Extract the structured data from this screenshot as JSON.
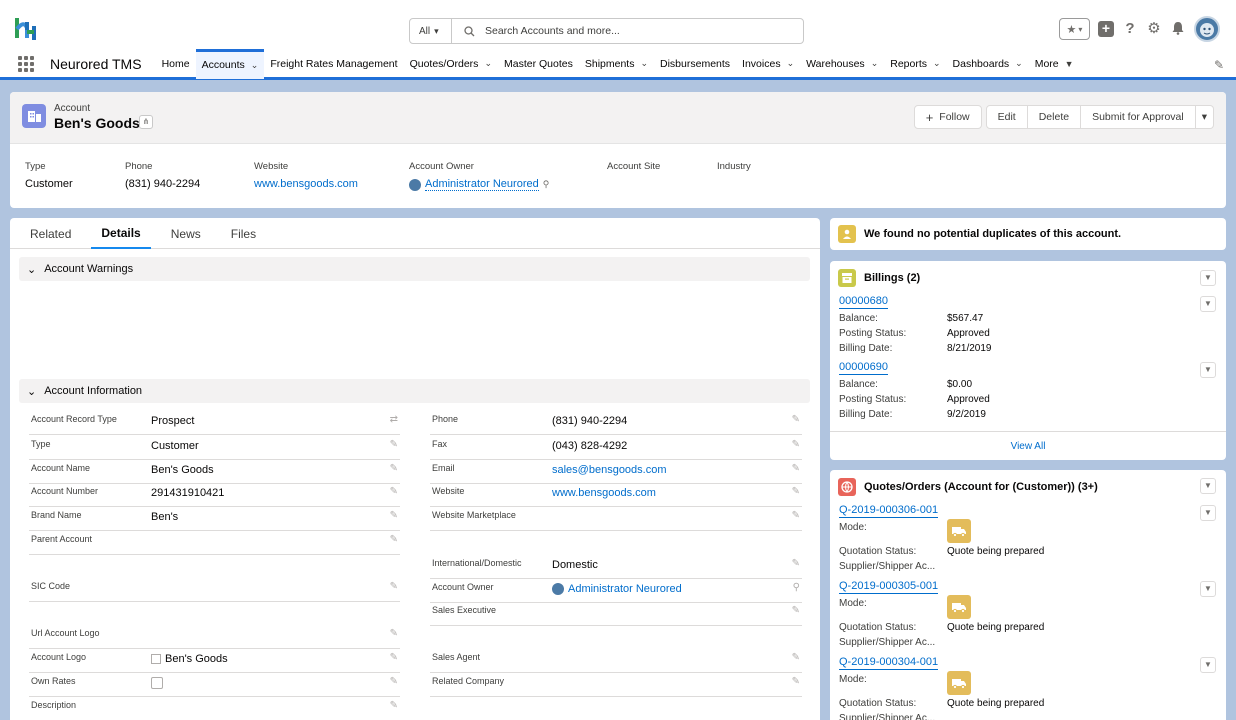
{
  "header": {
    "search_scope": "All",
    "search_placeholder": "Search Accounts and more..."
  },
  "nav": {
    "app_name": "Neurored TMS",
    "items": [
      {
        "label": "Home",
        "chevron": false
      },
      {
        "label": "Accounts",
        "chevron": true,
        "active": true
      },
      {
        "label": "Freight Rates Management",
        "chevron": false
      },
      {
        "label": "Quotes/Orders",
        "chevron": true
      },
      {
        "label": "Master Quotes",
        "chevron": false
      },
      {
        "label": "Shipments",
        "chevron": true
      },
      {
        "label": "Disbursements",
        "chevron": false
      },
      {
        "label": "Invoices",
        "chevron": true
      },
      {
        "label": "Warehouses",
        "chevron": true
      },
      {
        "label": "Reports",
        "chevron": true
      },
      {
        "label": "Dashboards",
        "chevron": true
      },
      {
        "label": "More",
        "chevron": true
      }
    ]
  },
  "record": {
    "object_label": "Account",
    "title": "Ben's Goods",
    "actions": {
      "follow": "Follow",
      "edit": "Edit",
      "delete": "Delete",
      "submit": "Submit for Approval"
    },
    "highlights": {
      "type_label": "Type",
      "type_value": "Customer",
      "phone_label": "Phone",
      "phone_value": "(831) 940-2294",
      "website_label": "Website",
      "website_value": "www.bensgoods.com",
      "owner_label": "Account Owner",
      "owner_value": "Administrator Neurored",
      "site_label": "Account Site",
      "industry_label": "Industry"
    }
  },
  "tabs": [
    "Related",
    "Details",
    "News",
    "Files"
  ],
  "sections": {
    "warnings": "Account Warnings",
    "info": "Account Information"
  },
  "left_fields": [
    {
      "label": "Account Record Type",
      "value": "Prospect"
    },
    {
      "label": "Type",
      "value": "Customer"
    },
    {
      "label": "Account Name",
      "value": "Ben's Goods"
    },
    {
      "label": "Account Number",
      "value": "291431910421"
    },
    {
      "label": "Brand Name",
      "value": "Ben's"
    },
    {
      "label": "Parent Account",
      "value": ""
    },
    {
      "label": "SIC Code",
      "value": ""
    },
    {
      "label": "Url Account Logo",
      "value": ""
    },
    {
      "label": "Account Logo",
      "value": "Ben's Goods"
    },
    {
      "label": "Own Rates",
      "value": ""
    },
    {
      "label": "Description",
      "value": ""
    }
  ],
  "right_fields": [
    {
      "label": "Phone",
      "value": "(831) 940-2294"
    },
    {
      "label": "Fax",
      "value": "(043) 828-4292"
    },
    {
      "label": "Email",
      "value": "sales@bensgoods.com"
    },
    {
      "label": "Website",
      "value": "www.bensgoods.com"
    },
    {
      "label": "Website Marketplace",
      "value": ""
    },
    {
      "label": "International/Domestic",
      "value": "Domestic"
    },
    {
      "label": "Account Owner",
      "value": "Administrator Neurored"
    },
    {
      "label": "Sales Executive",
      "value": ""
    },
    {
      "label": "Sales Agent",
      "value": ""
    },
    {
      "label": "Related Company",
      "value": ""
    }
  ],
  "duplicates": {
    "text": "We found no potential duplicates of this account."
  },
  "billings": {
    "title": "Billings (2)",
    "items": [
      {
        "id": "00000680",
        "balance_label": "Balance:",
        "balance": "$567.47",
        "status_label": "Posting Status:",
        "status": "Approved",
        "date_label": "Billing Date:",
        "date": "8/21/2019"
      },
      {
        "id": "00000690",
        "balance_label": "Balance:",
        "balance": "$0.00",
        "status_label": "Posting Status:",
        "status": "Approved",
        "date_label": "Billing Date:",
        "date": "9/2/2019"
      }
    ],
    "view_all": "View All"
  },
  "quotes": {
    "title": "Quotes/Orders (Account for (Customer)) (3+)",
    "items": [
      {
        "id": "Q-2019-000306-001",
        "mode_label": "Mode:",
        "status_label": "Quotation Status:",
        "status": "Quote being prepared",
        "supplier_label": "Supplier/Shipper Ac..."
      },
      {
        "id": "Q-2019-000305-001",
        "mode_label": "Mode:",
        "status_label": "Quotation Status:",
        "status": "Quote being prepared",
        "supplier_label": "Supplier/Shipper Ac..."
      },
      {
        "id": "Q-2019-000304-001",
        "mode_label": "Mode:",
        "status_label": "Quotation Status:",
        "status": "Quote being prepared",
        "supplier_label": "Supplier/Shipper Ac..."
      }
    ]
  },
  "colors": {
    "brand_blue": "#1f6fd8",
    "link": "#006dcc",
    "account_icon": "#7f8de1",
    "billing_icon": "#c9c94a",
    "quote_icon": "#e8645a",
    "duplicate_icon": "#e3c24e",
    "shipment_icon": "#e3bc5b"
  }
}
